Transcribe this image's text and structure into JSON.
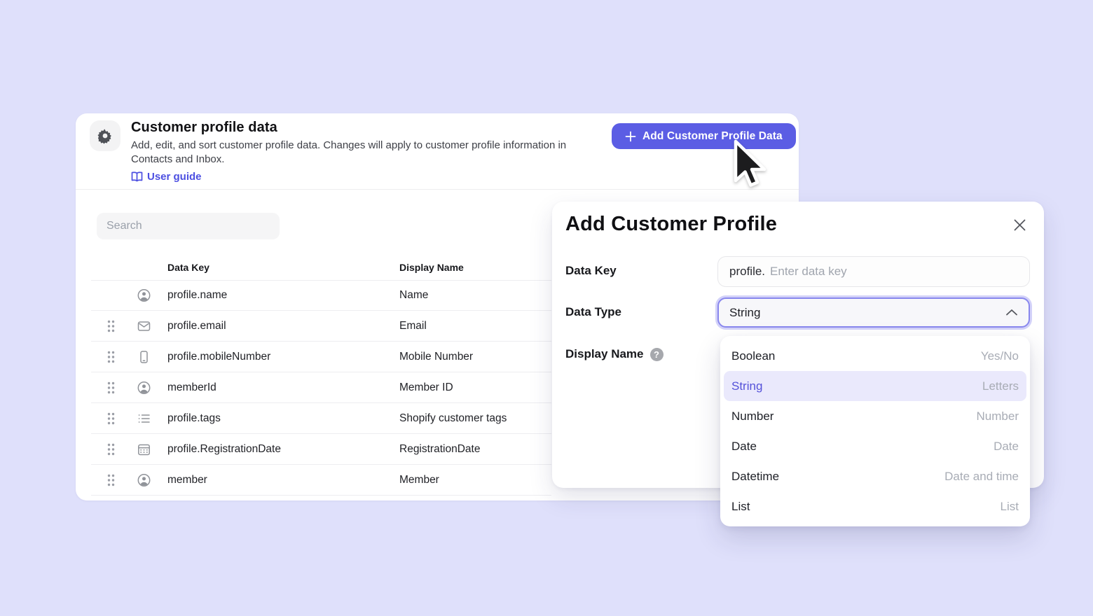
{
  "header": {
    "title": "Customer profile data",
    "description": "Add, edit, and sort customer profile data. Changes will apply to customer profile information in Contacts and Inbox.",
    "user_guide_label": "User guide",
    "add_button_label": "Add Customer Profile Data"
  },
  "toolbar": {
    "search_placeholder": "Search"
  },
  "table": {
    "columns": [
      "Data Key",
      "Display Name"
    ],
    "rows": [
      {
        "icon": "person-icon",
        "data_key": "profile.name",
        "display_name": "Name"
      },
      {
        "icon": "envelope-icon",
        "data_key": "profile.email",
        "display_name": "Email"
      },
      {
        "icon": "phone-icon",
        "data_key": "profile.mobileNumber",
        "display_name": "Mobile Number"
      },
      {
        "icon": "person-icon",
        "data_key": "memberId",
        "display_name": "Member ID"
      },
      {
        "icon": "list-icon",
        "data_key": "profile.tags",
        "display_name": "Shopify customer tags"
      },
      {
        "icon": "calendar-icon",
        "data_key": "profile.RegistrationDate",
        "display_name": "RegistrationDate"
      },
      {
        "icon": "person-icon",
        "data_key": "member",
        "display_name": "Member"
      }
    ]
  },
  "modal": {
    "title": "Add Customer Profile",
    "fields": {
      "data_key": {
        "label": "Data Key",
        "prefix": "profile.",
        "placeholder": "Enter data key"
      },
      "data_type": {
        "label": "Data Type",
        "value": "String"
      },
      "display_name": {
        "label": "Display Name"
      }
    },
    "dropdown": {
      "options": [
        {
          "label": "Boolean",
          "hint": "Yes/No",
          "selected": false
        },
        {
          "label": "String",
          "hint": "Letters",
          "selected": true
        },
        {
          "label": "Number",
          "hint": "Number",
          "selected": false
        },
        {
          "label": "Date",
          "hint": "Date",
          "selected": false
        },
        {
          "label": "Datetime",
          "hint": "Date and time",
          "selected": false
        },
        {
          "label": "List",
          "hint": "List",
          "selected": false
        }
      ]
    }
  },
  "colors": {
    "page_background": "#dfe0fb",
    "accent_purple": "#5b5de4",
    "link_purple": "#4c4fe1",
    "selected_option_bg": "#eae9fc",
    "selected_option_text": "#5451d9",
    "focus_border": "#8987ee",
    "focus_ring": "#d3d2f9"
  }
}
